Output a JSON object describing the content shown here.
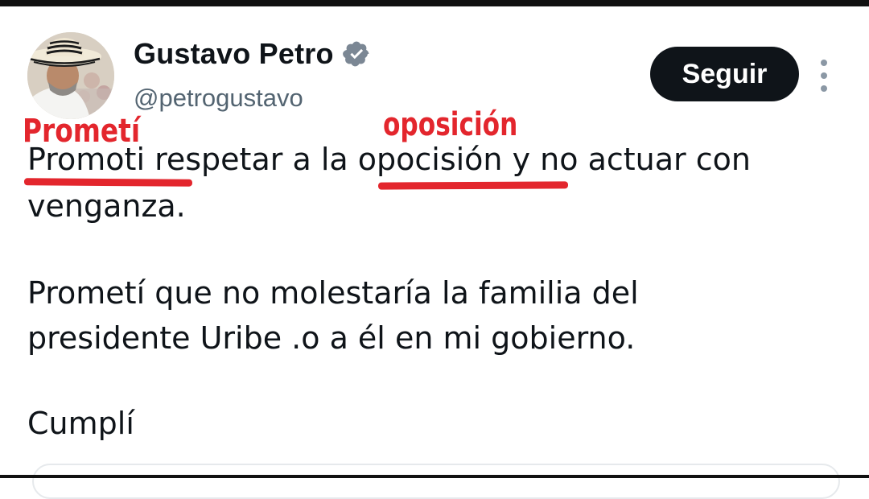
{
  "author": {
    "display_name": "Gustavo Petro",
    "handle": "@petrogustavo",
    "verified": true,
    "avatar_icon": "profile-photo-man-with-sombrero-vueltiao"
  },
  "actions": {
    "follow_label": "Seguir",
    "more_icon": "vertical-ellipsis-icon"
  },
  "tweet": {
    "line1_part1": "Promoti",
    "line1_part2": " respetar a la ",
    "line1_part3": "opocisión",
    "line1_part4": " y no actuar con",
    "line2": "venganza.",
    "line3": "Prometí que no molestaría la familia del",
    "line4": "presidente Uribe .o a él en mi gobierno.",
    "line5": "Cumplí"
  },
  "annotations": {
    "correction_1": "Prometí",
    "correction_2": "oposición",
    "color": "#e3262d"
  },
  "colors": {
    "text": "#0f1419",
    "secondary": "#536471",
    "verified_badge": "#7b8794",
    "button_bg": "#0f1419"
  }
}
